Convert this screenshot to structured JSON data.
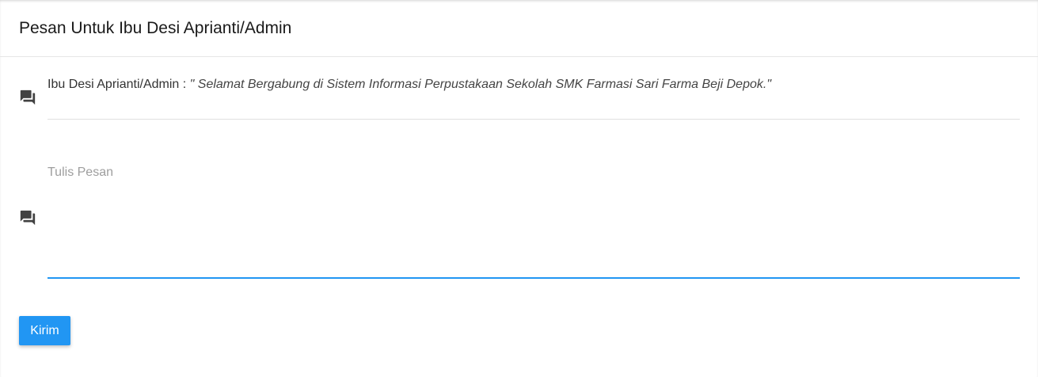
{
  "header": {
    "title": "Pesan Untuk Ibu Desi Aprianti/Admin"
  },
  "message": {
    "sender_label": "Ibu Desi Aprianti/Admin :",
    "text": "\" Selamat Bergabung di Sistem Informasi Perpustakaan Sekolah SMK Farmasi Sari Farma Beji Depok.\"",
    "icon": "forum-icon"
  },
  "compose": {
    "label": "Tulis Pesan",
    "value": "",
    "icon": "forum-icon"
  },
  "actions": {
    "send_label": "Kirim"
  },
  "colors": {
    "accent": "#2196f3",
    "icon": "#424242",
    "divider": "#e0e0e0"
  }
}
